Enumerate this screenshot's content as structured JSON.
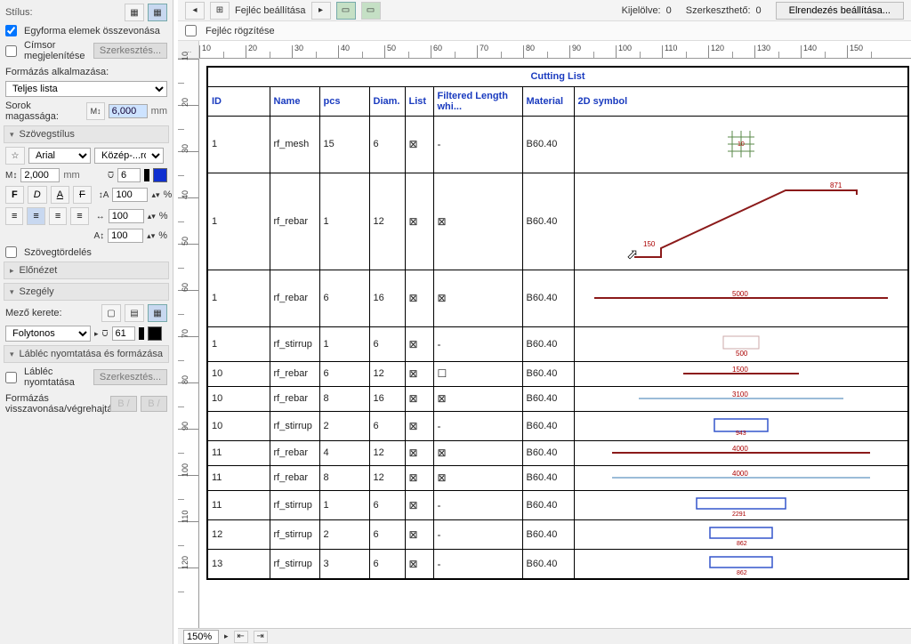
{
  "left": {
    "style_label": "Stílus:",
    "merge_label": "Egyforma elemek összevonása",
    "merge_checked": true,
    "titlerow_label": "Címsor megjelenítése",
    "titlerow_checked": false,
    "edit_btn": "Szerkesztés...",
    "format_apply_label": "Formázás alkalmazása:",
    "format_apply_value": "Teljes lista",
    "row_height_label": "Sorok magassága:",
    "row_height_value": "6,000",
    "row_height_unit": "mm",
    "section_text": "Szövegstílus",
    "font_name": "Arial",
    "font_region": "Közép-...rópai",
    "font_size": "2,000",
    "font_size_unit": "mm",
    "pen_weight": "6",
    "scale1": "100",
    "scale2": "100",
    "scale3": "100",
    "pct": "%",
    "wrap_label": "Szövegtördelés",
    "section_preview": "Előnézet",
    "section_border": "Szegély",
    "cell_frame_label": "Mező kerete:",
    "line_type": "Folytonos",
    "line_pen": "61",
    "section_footer": "Lábléc nyomtatása és formázása",
    "footer_print_label": "Lábléc nyomtatása",
    "undo_label": "Formázás visszavonása/végrehajtása:",
    "undo_b1": "B /",
    "undo_b2": "B /"
  },
  "top": {
    "header_set_label": "Fejléc beállítása",
    "selected_label": "Kijelölve:",
    "selected_count": "0",
    "editable_label": "Szerkeszthető:",
    "editable_count": "0",
    "layout_btn": "Elrendezés beállítása...",
    "freeze_header_label": "Fejléc rögzítése",
    "corner": "..."
  },
  "ruler_h": [
    "10",
    "20",
    "30",
    "40",
    "50",
    "60",
    "70",
    "80",
    "90",
    "100",
    "110",
    "120",
    "130",
    "140",
    "150"
  ],
  "ruler_v": [
    "10",
    "20",
    "30",
    "40",
    "50",
    "60",
    "70",
    "80",
    "90",
    "100",
    "110",
    "120"
  ],
  "table": {
    "title": "Cutting List",
    "headers": {
      "id": "ID",
      "name": "Name",
      "pcs": "pcs",
      "diam": "Diam.",
      "list": "List",
      "filt": "Filtered Length whi...",
      "mat": "Material",
      "sym": "2D symbol"
    },
    "rows": [
      {
        "id": "1",
        "name": "rf_mesh",
        "pcs": "15",
        "diam": "6",
        "list": "⊠",
        "filt": "-",
        "mat": "B60.40",
        "sym": "mesh",
        "h": "med"
      },
      {
        "id": "1",
        "name": "rf_rebar",
        "pcs": "1",
        "diam": "12",
        "list": "⊠",
        "filt": "⊠",
        "mat": "B60.40",
        "sym": "bent",
        "h": "tall"
      },
      {
        "id": "1",
        "name": "rf_rebar",
        "pcs": "6",
        "diam": "16",
        "list": "⊠",
        "filt": "⊠",
        "mat": "B60.40",
        "sym": "bar5000",
        "h": "med"
      },
      {
        "id": "1",
        "name": "rf_stirrup",
        "pcs": "1",
        "diam": "6",
        "list": "⊠",
        "filt": "-",
        "mat": "B60.40",
        "sym": "stirrup-small"
      },
      {
        "id": "10",
        "name": "rf_rebar",
        "pcs": "6",
        "diam": "12",
        "list": "⊠",
        "filt": "☐",
        "mat": "B60.40",
        "sym": "bar1500"
      },
      {
        "id": "10",
        "name": "rf_rebar",
        "pcs": "8",
        "diam": "16",
        "list": "⊠",
        "filt": "⊠",
        "mat": "B60.40",
        "sym": "bar3100"
      },
      {
        "id": "10",
        "name": "rf_stirrup",
        "pcs": "2",
        "diam": "6",
        "list": "⊠",
        "filt": "-",
        "mat": "B60.40",
        "sym": "stirrup-blue"
      },
      {
        "id": "11",
        "name": "rf_rebar",
        "pcs": "4",
        "diam": "12",
        "list": "⊠",
        "filt": "⊠",
        "mat": "B60.40",
        "sym": "bar4000r"
      },
      {
        "id": "11",
        "name": "rf_rebar",
        "pcs": "8",
        "diam": "12",
        "list": "⊠",
        "filt": "⊠",
        "mat": "B60.40",
        "sym": "bar4000b"
      },
      {
        "id": "11",
        "name": "rf_stirrup",
        "pcs": "1",
        "diam": "6",
        "list": "⊠",
        "filt": "-",
        "mat": "B60.40",
        "sym": "stirrup-blue2"
      },
      {
        "id": "12",
        "name": "rf_stirrup",
        "pcs": "2",
        "diam": "6",
        "list": "⊠",
        "filt": "-",
        "mat": "B60.40",
        "sym": "stirrup-blue3"
      },
      {
        "id": "13",
        "name": "rf_stirrup",
        "pcs": "3",
        "diam": "6",
        "list": "⊠",
        "filt": "-",
        "mat": "B60.40",
        "sym": "stirrup-blue3"
      }
    ]
  },
  "chart_data": {
    "type": "table",
    "title": "Cutting List",
    "columns": [
      "ID",
      "Name",
      "pcs",
      "Diam.",
      "List",
      "Filtered Length whi...",
      "Material",
      "2D symbol"
    ],
    "rows": [
      [
        "1",
        "rf_mesh",
        "15",
        "6",
        "checked",
        "-",
        "B60.40",
        "mesh-grid"
      ],
      [
        "1",
        "rf_rebar",
        "1",
        "12",
        "checked",
        "checked",
        "B60.40",
        "bent-bar 871/150"
      ],
      [
        "1",
        "rf_rebar",
        "6",
        "16",
        "checked",
        "checked",
        "B60.40",
        "straight 5000"
      ],
      [
        "1",
        "rf_stirrup",
        "1",
        "6",
        "checked",
        "-",
        "B60.40",
        "stirrup 500"
      ],
      [
        "10",
        "rf_rebar",
        "6",
        "12",
        "checked",
        "unchecked",
        "B60.40",
        "straight 1500"
      ],
      [
        "10",
        "rf_rebar",
        "8",
        "16",
        "checked",
        "checked",
        "B60.40",
        "straight 3100"
      ],
      [
        "10",
        "rf_stirrup",
        "2",
        "6",
        "checked",
        "-",
        "B60.40",
        "rect-stirrup"
      ],
      [
        "11",
        "rf_rebar",
        "4",
        "12",
        "checked",
        "checked",
        "B60.40",
        "straight 4000"
      ],
      [
        "11",
        "rf_rebar",
        "8",
        "12",
        "checked",
        "checked",
        "B60.40",
        "straight 4000"
      ],
      [
        "11",
        "rf_stirrup",
        "1",
        "6",
        "checked",
        "-",
        "B60.40",
        "rect-stirrup 2291"
      ],
      [
        "12",
        "rf_stirrup",
        "2",
        "6",
        "checked",
        "-",
        "B60.40",
        "rect-stirrup"
      ],
      [
        "13",
        "rf_stirrup",
        "3",
        "6",
        "checked",
        "-",
        "B60.40",
        "rect-stirrup"
      ]
    ]
  },
  "bottom": {
    "zoom": "150%"
  }
}
